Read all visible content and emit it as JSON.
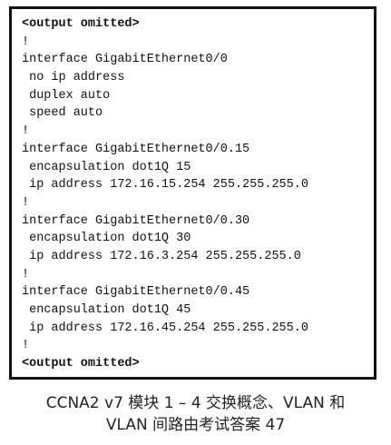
{
  "config": {
    "lines": [
      "<output omitted>",
      "!",
      "interface GigabitEthernet0/0",
      " no ip address",
      " duplex auto",
      " speed auto",
      "!",
      "interface GigabitEthernet0/0.15",
      " encapsulation dot1Q 15",
      " ip address 172.16.15.254 255.255.255.0",
      "!",
      "interface GigabitEthernet0/0.30",
      " encapsulation dot1Q 30",
      " ip address 172.16.3.254 255.255.255.0",
      "!",
      "interface GigabitEthernet0/0.45",
      " encapsulation dot1Q 45",
      " ip address 172.16.45.254 255.255.255.0",
      "!",
      "<output omitted>"
    ]
  },
  "caption": {
    "line1": "CCNA2 v7 模块 1 – 4 交换概念、VLAN 和",
    "line2": "VLAN 间路由考试答案 47"
  }
}
